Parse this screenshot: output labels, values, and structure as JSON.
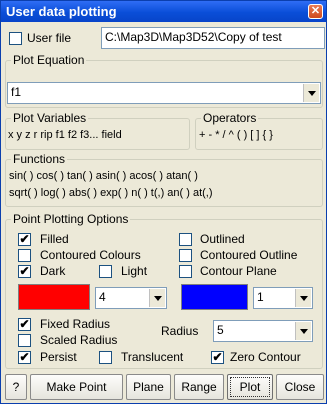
{
  "window": {
    "title": "User data plotting",
    "close_glyph": "✕"
  },
  "user_file": {
    "label": "User file",
    "checked": false,
    "path": "C:\\Map3D\\Map3D52\\Copy of test"
  },
  "plot_equation": {
    "legend": "Plot Equation",
    "value": "f1"
  },
  "plot_variables": {
    "legend": "Plot Variables",
    "text": "x y z r rip  f1 f2 f3... field"
  },
  "operators": {
    "legend": "Operators",
    "text": "+ - * / ^  ( )  [ ]  { }"
  },
  "functions": {
    "legend": "Functions",
    "line1": "sin( ) cos( ) tan( ) asin( ) acos( ) atan( )",
    "line2": "sqrt( ) log( ) abs( ) exp( ) n( ) t(,) an( ) at(,)"
  },
  "options": {
    "legend": "Point Plotting Options",
    "filled": {
      "label": "Filled",
      "checked": true
    },
    "outlined": {
      "label": "Outlined",
      "checked": false
    },
    "contoured_colours": {
      "label": "Contoured Colours",
      "checked": false
    },
    "contoured_outline": {
      "label": "Contoured Outline",
      "checked": false
    },
    "dark": {
      "label": "Dark",
      "checked": true
    },
    "light": {
      "label": "Light",
      "checked": false
    },
    "contour_plane": {
      "label": "Contour Plane",
      "checked": false
    },
    "fill_color": "#ff0000",
    "fill_size": "4",
    "outline_color": "#0000ff",
    "outline_size": "1",
    "fixed_radius": {
      "label": "Fixed Radius",
      "checked": true
    },
    "scaled_radius": {
      "label": "Scaled Radius",
      "checked": false
    },
    "radius": {
      "label": "Radius",
      "value": "5"
    },
    "persist": {
      "label": "Persist",
      "checked": true
    },
    "translucent": {
      "label": "Translucent",
      "checked": false
    },
    "zero_contour": {
      "label": "Zero Contour",
      "checked": true
    }
  },
  "buttons": {
    "help": "?",
    "make_point": "Make Point",
    "plane": "Plane",
    "range": "Range",
    "plot": "Plot",
    "close": "Close"
  },
  "check_glyph": "✔"
}
